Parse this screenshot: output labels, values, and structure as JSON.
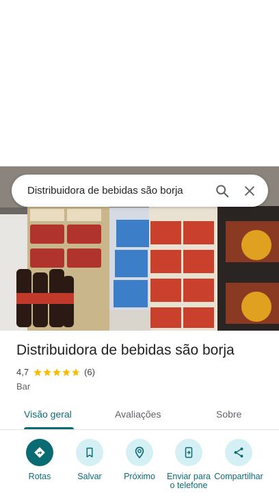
{
  "search": {
    "query": "Distribuidora de bebidas são borja",
    "search_icon": "search-icon",
    "close_icon": "close-icon"
  },
  "place": {
    "name": "Distribuidora de bebidas são borja",
    "rating": "4,7",
    "rating_value": 4.7,
    "reviews": "(6)",
    "category": "Bar",
    "star_color": "#fbbc04"
  },
  "tabs": [
    {
      "label": "Visão geral",
      "active": true
    },
    {
      "label": "Avaliações",
      "active": false
    },
    {
      "label": "Sobre",
      "active": false
    }
  ],
  "actions": [
    {
      "label": "Rotas",
      "icon": "directions-icon"
    },
    {
      "label": "Salvar",
      "icon": "bookmark-icon"
    },
    {
      "label": "Próximo",
      "icon": "nearby-icon"
    },
    {
      "label": "Enviar para o telefone",
      "icon": "send-to-phone-icon"
    },
    {
      "label": "Compartilhar",
      "icon": "share-icon"
    }
  ],
  "colors": {
    "accent": "#0b6b72",
    "accent_light": "#d5f0f5"
  }
}
